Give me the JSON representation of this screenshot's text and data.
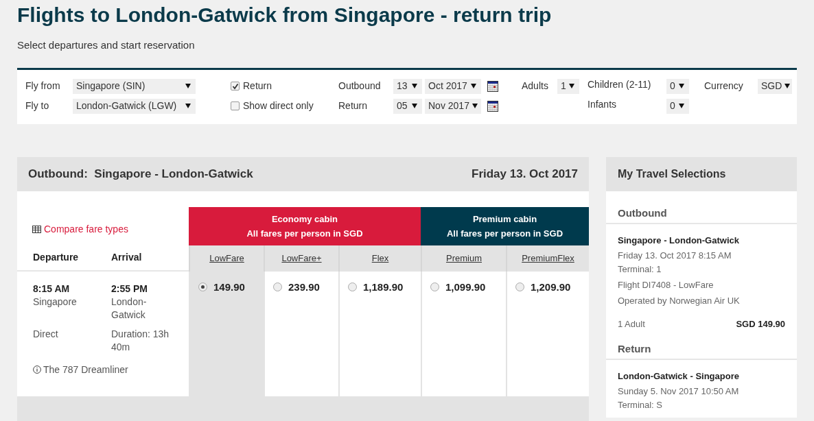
{
  "page": {
    "title": "Flights to London-Gatwick from Singapore - return trip",
    "subtitle": "Select departures and start reservation"
  },
  "search": {
    "fly_from": {
      "label": "Fly from",
      "value": "Singapore (SIN)"
    },
    "fly_to": {
      "label": "Fly to",
      "value": "London-Gatwick (LGW)"
    },
    "return_trip": {
      "label": "Return",
      "checked": true
    },
    "direct_only": {
      "label": "Show direct only",
      "checked": false
    },
    "outbound_date": {
      "label": "Outbound",
      "day": "13",
      "month": "Oct 2017"
    },
    "return_date": {
      "label": "Return",
      "day": "05",
      "month": "Nov 2017"
    },
    "adults": {
      "label": "Adults",
      "value": "1"
    },
    "children": {
      "label": "Children (2-11)",
      "value": "0"
    },
    "infants": {
      "label": "Infants",
      "value": "0"
    },
    "currency": {
      "label": "Currency",
      "value": "SGD"
    }
  },
  "outbound": {
    "title": "Outbound:  Singapore - London-Gatwick",
    "date": "Friday 13. Oct 2017",
    "compare_link": "Compare fare types",
    "departure_heading": "Departure",
    "arrival_heading": "Arrival",
    "cabins": [
      {
        "name": "Economy cabin",
        "subtitle": "All fares per person in SGD",
        "color": "#d81b3c",
        "fares": [
          {
            "name": "LowFare",
            "price": "149.90",
            "selected": true
          },
          {
            "name": "LowFare+",
            "price": "239.90",
            "selected": false
          },
          {
            "name": "Flex",
            "price": "1,189.90",
            "selected": false
          }
        ]
      },
      {
        "name": "Premium cabin",
        "subtitle": "All fares per person in SGD",
        "color": "#003a4d",
        "fares": [
          {
            "name": "Premium",
            "price": "1,099.90",
            "selected": false
          },
          {
            "name": "PremiumFlex",
            "price": "1,209.90",
            "selected": false
          }
        ]
      }
    ],
    "flight": {
      "departure_time": "8:15 AM",
      "departure_city": "Singapore",
      "arrival_time": "2:55 PM",
      "arrival_city": "London-Gatwick",
      "stops": "Direct",
      "duration": "Duration: 13h 40m",
      "aircraft": "The 787 Dreamliner"
    }
  },
  "selections": {
    "title": "My Travel Selections",
    "sections": [
      {
        "heading": "Outbound",
        "route": "Singapore - London-Gatwick",
        "lines": [
          "Friday 13. Oct 2017 8:15 AM",
          "Terminal: 1",
          "Flight DI7408 - LowFare",
          "Operated by Norwegian Air UK"
        ],
        "passengers": "1 Adult",
        "price": "SGD 149.90"
      },
      {
        "heading": "Return",
        "route": "London-Gatwick - Singapore",
        "lines": [
          "Sunday 5. Nov 2017 10:50 AM",
          "Terminal: S"
        ]
      }
    ]
  }
}
